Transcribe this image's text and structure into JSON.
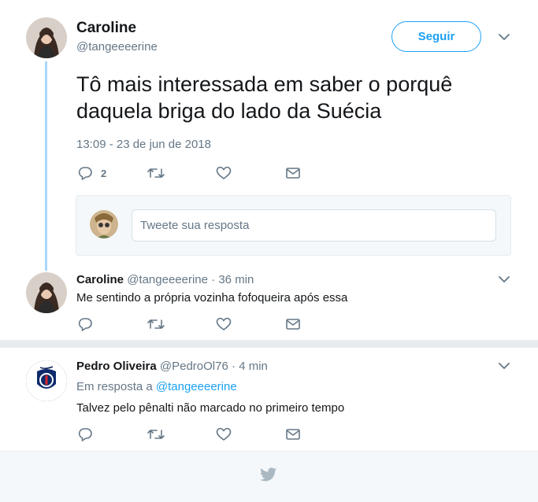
{
  "main_tweet": {
    "name": "Caroline",
    "handle": "@tangeeeerine",
    "follow_label": "Seguir",
    "text": "Tô mais interessada em saber o porquê daquela briga do lado da Suécia",
    "timestamp": "13:09 - 23 de jun de 2018",
    "reply_count": "2"
  },
  "reply_box": {
    "placeholder": "Tweete sua resposta"
  },
  "replies": [
    {
      "name": "Caroline",
      "handle": "@tangeeeerine",
      "sep": "·",
      "time": "36 min",
      "in_reply_prefix": "",
      "in_reply_handle": "",
      "text": "Me sentindo a própria vozinha fofoqueira após essa"
    },
    {
      "name": "Pedro Oliveira",
      "handle": "@PedroOl76",
      "sep": "·",
      "time": "4 min",
      "in_reply_prefix": "Em resposta a",
      "in_reply_handle": "@tangeeeerine",
      "text": "Talvez pelo pênalti não marcado no primeiro tempo"
    }
  ],
  "icons": {
    "reply": "reply-icon",
    "retweet": "retweet-icon",
    "like": "heart-icon",
    "dm": "envelope-icon",
    "more": "chevron-down-icon",
    "brand": "twitter-bird-icon"
  },
  "colors": {
    "accent": "#1da1f2",
    "thread_line": "#a8d7fa",
    "muted": "#657786"
  }
}
